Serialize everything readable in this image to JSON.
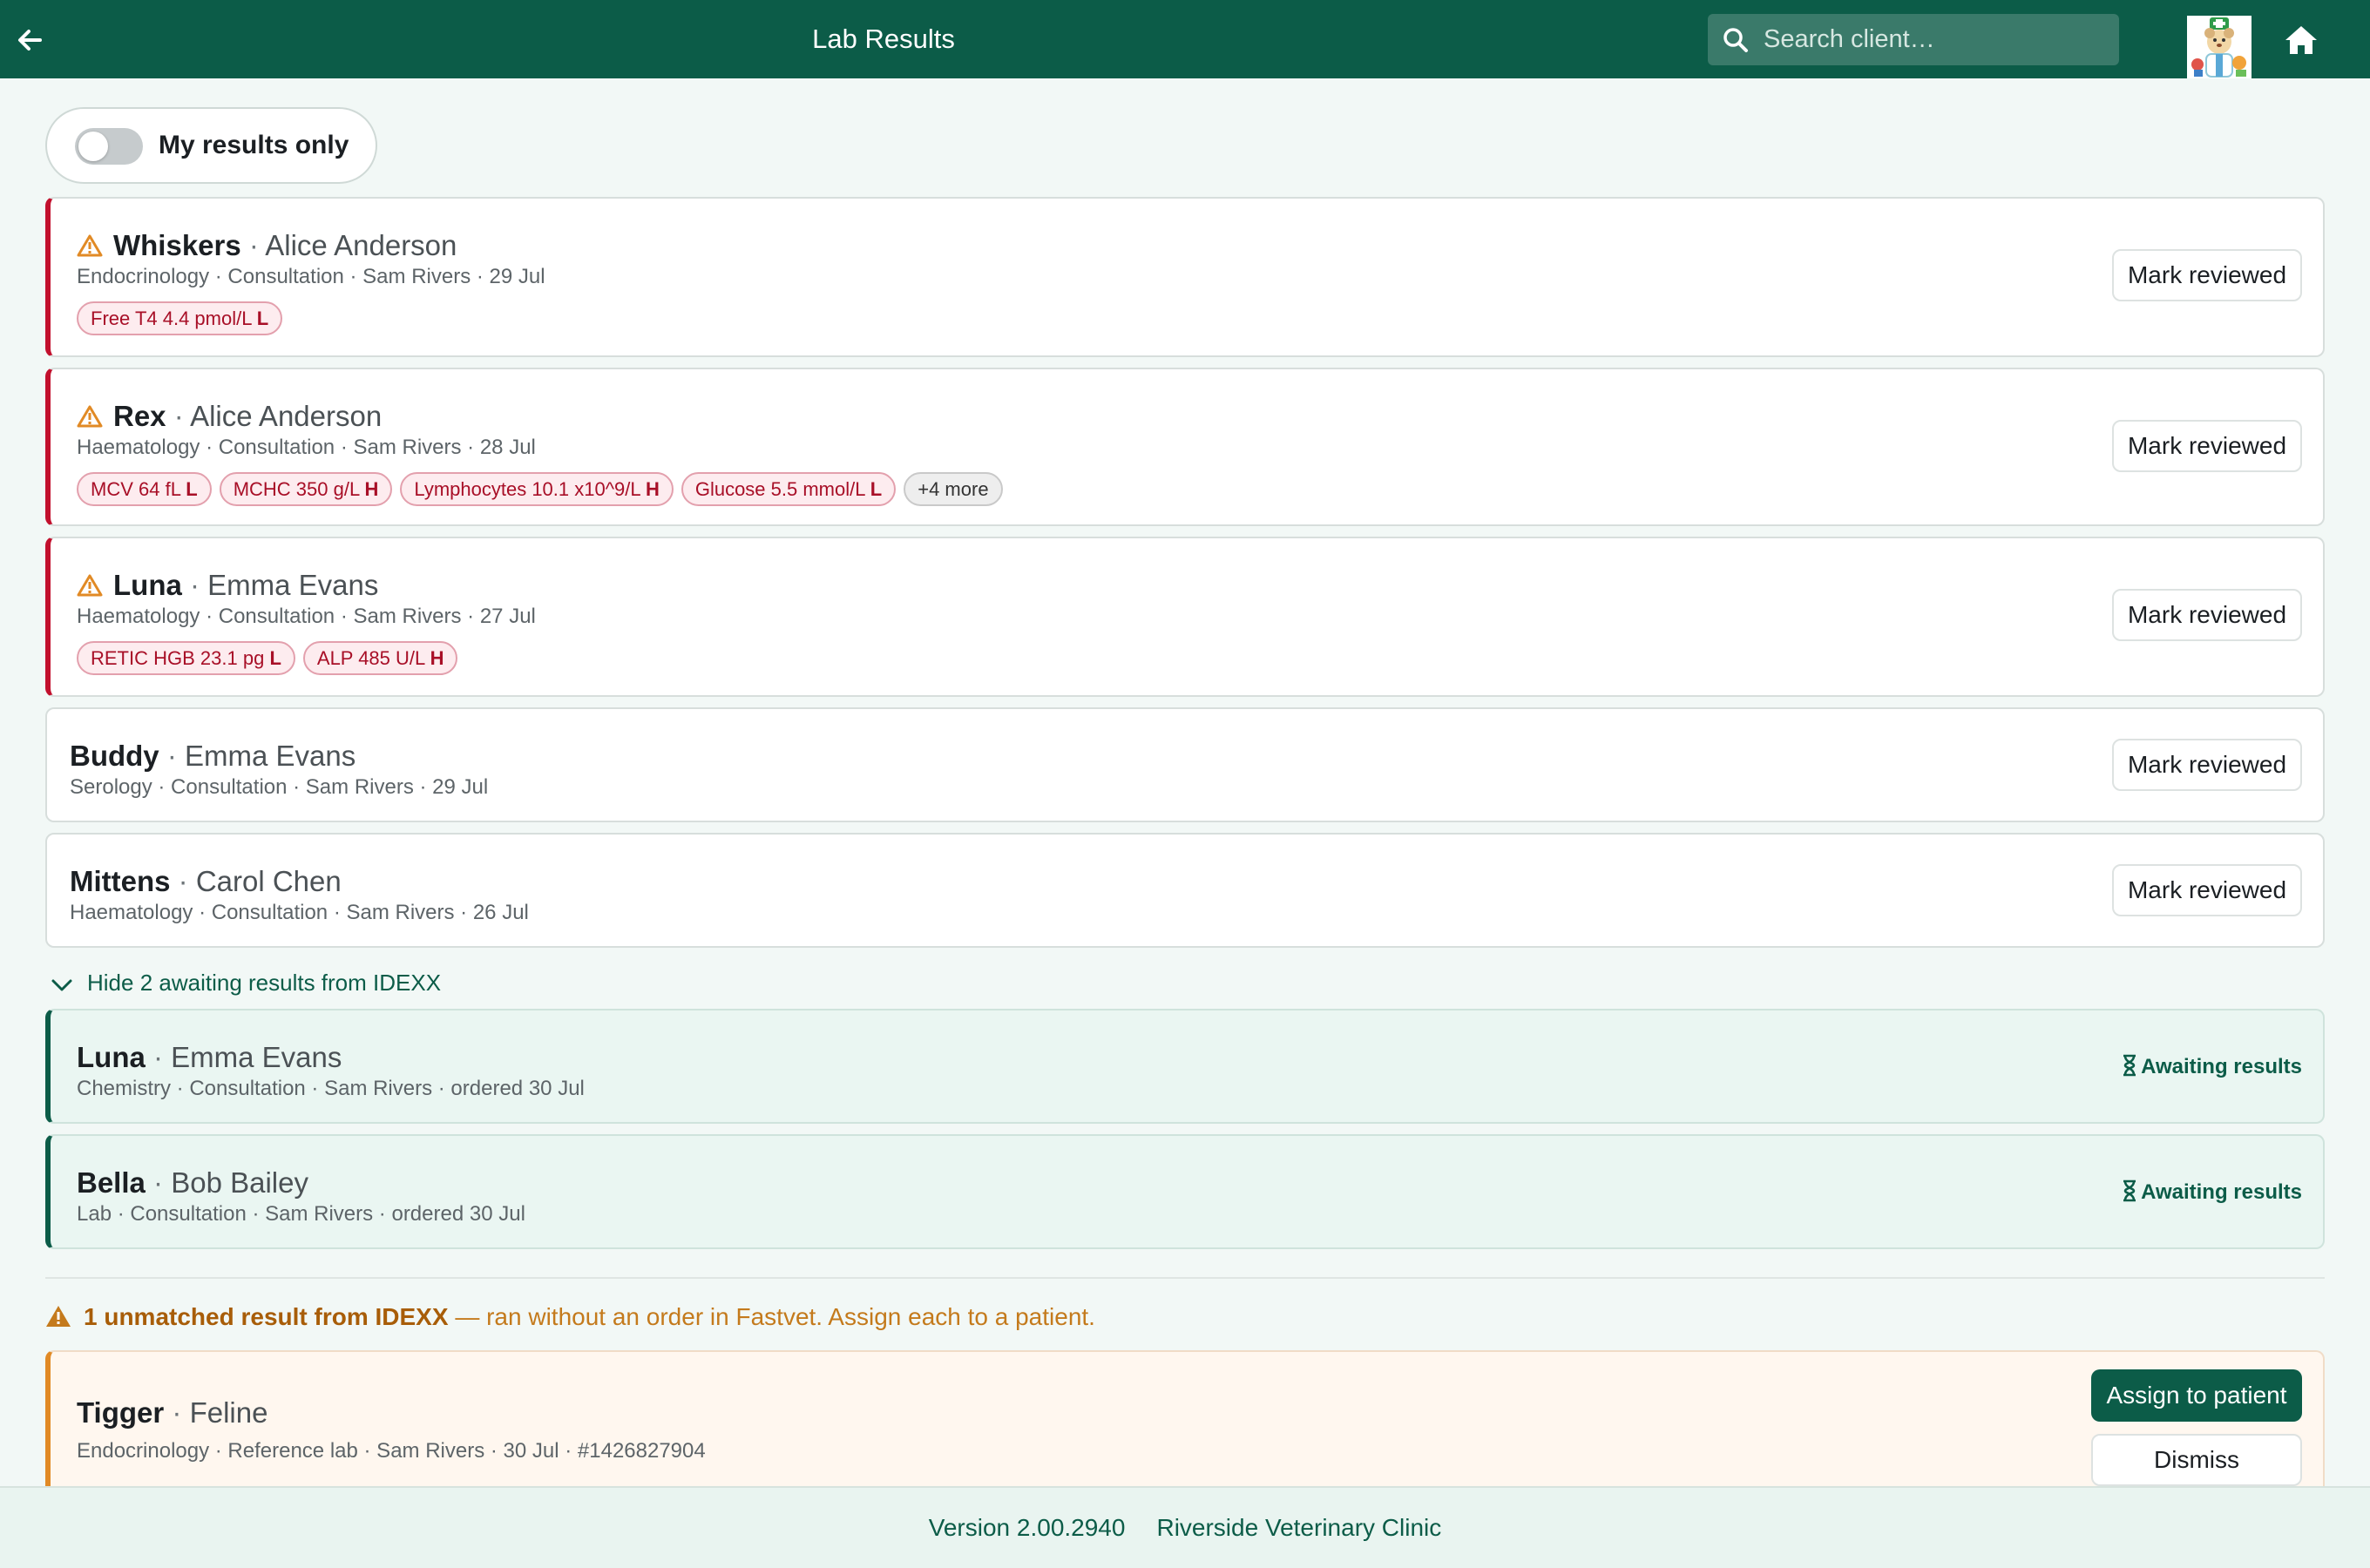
{
  "header": {
    "title": "Lab Results",
    "search_placeholder": "Search client…"
  },
  "filter": {
    "my_results_only_label": "My results only",
    "my_results_only_on": false
  },
  "results": [
    {
      "pet": "Whiskers",
      "owner": "Alice Anderson",
      "meta": "Endocrinology · Consultation · Sam Rivers · 29 Jul",
      "flagged": true,
      "chips": [
        {
          "text": "Free T4 4.4 pmol/L",
          "flag": "L"
        }
      ],
      "more": "",
      "action": "Mark reviewed"
    },
    {
      "pet": "Rex",
      "owner": "Alice Anderson",
      "meta": "Haematology · Consultation · Sam Rivers · 28 Jul",
      "flagged": true,
      "chips": [
        {
          "text": "MCV 64 fL",
          "flag": "L"
        },
        {
          "text": "MCHC 350 g/L",
          "flag": "H"
        },
        {
          "text": "Lymphocytes 10.1 x10^9/L",
          "flag": "H"
        },
        {
          "text": "Glucose 5.5 mmol/L",
          "flag": "L"
        }
      ],
      "more": "+4 more",
      "action": "Mark reviewed"
    },
    {
      "pet": "Luna",
      "owner": "Emma Evans",
      "meta": "Haematology · Consultation · Sam Rivers · 27 Jul",
      "flagged": true,
      "chips": [
        {
          "text": "RETIC HGB 23.1 pg",
          "flag": "L"
        },
        {
          "text": "ALP 485 U/L",
          "flag": "H"
        }
      ],
      "more": "",
      "action": "Mark reviewed"
    },
    {
      "pet": "Buddy",
      "owner": "Emma Evans",
      "meta": "Serology · Consultation · Sam Rivers · 29 Jul",
      "flagged": false,
      "chips": [],
      "more": "",
      "action": "Mark reviewed"
    },
    {
      "pet": "Mittens",
      "owner": "Carol Chen",
      "meta": "Haematology · Consultation · Sam Rivers · 26 Jul",
      "flagged": false,
      "chips": [],
      "more": "",
      "action": "Mark reviewed"
    }
  ],
  "awaiting_toggle": "Hide 2 awaiting results from IDEXX",
  "awaiting": [
    {
      "pet": "Luna",
      "owner": "Emma Evans",
      "meta": "Chemistry · Consultation · Sam Rivers · ordered 30 Jul",
      "status": "Awaiting results"
    },
    {
      "pet": "Bella",
      "owner": "Bob Bailey",
      "meta": "Lab · Consultation · Sam Rivers · ordered 30 Jul",
      "status": "Awaiting results"
    }
  ],
  "unmatched_note": {
    "strong": "1 unmatched result from IDEXX",
    "rest": " — ran without an order in Fastvet. Assign each to a patient."
  },
  "unmatched": [
    {
      "pet": "Tigger",
      "species": "Feline",
      "meta": "Endocrinology · Reference lab · Sam Rivers · 30 Jul · #1426827904",
      "assign_label": "Assign to patient",
      "dismiss_label": "Dismiss"
    }
  ],
  "footer": {
    "version": "Version 2.00.2940",
    "clinic": "Riverside Veterinary Clinic"
  },
  "colors": {
    "brand": "#0c5c48",
    "flag_red": "#c2102d",
    "warning_orange": "#e18a25"
  }
}
